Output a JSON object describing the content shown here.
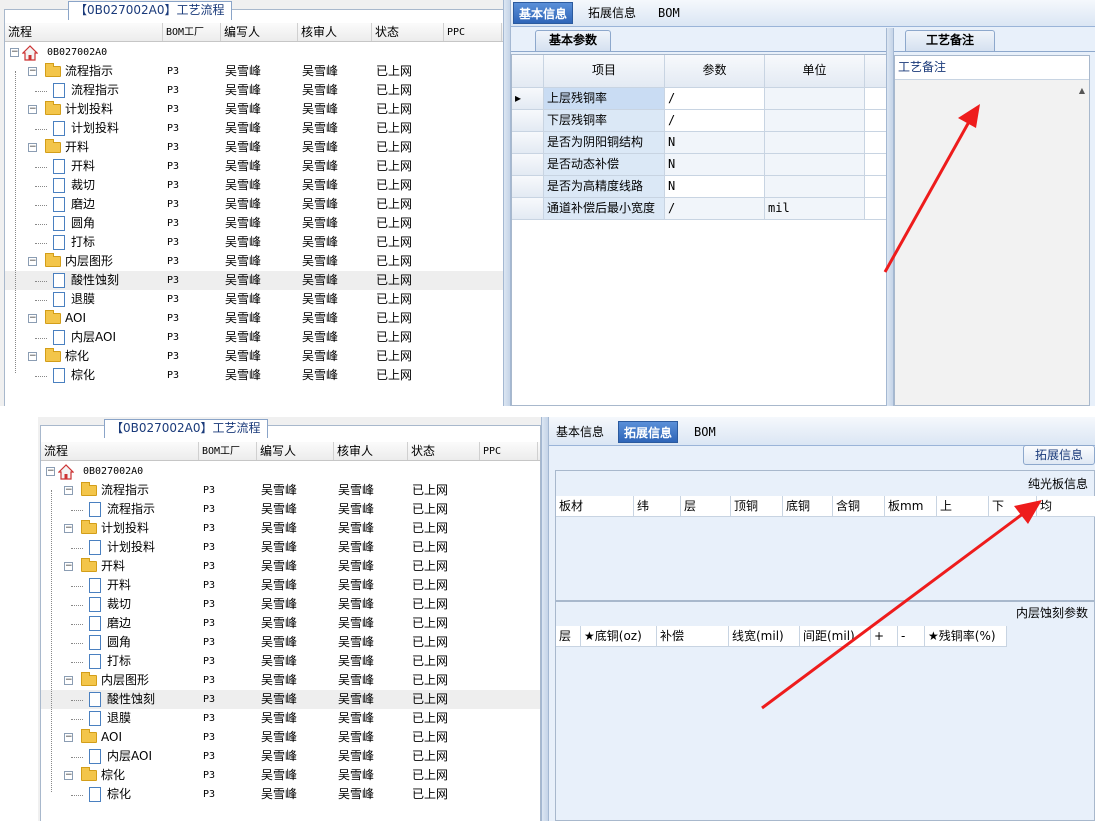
{
  "screen1": {
    "left_title": "【0B027002A0】工艺流程",
    "columns": [
      "流程",
      "BOM工厂",
      "编写人",
      "核审人",
      "状态",
      "PPC"
    ],
    "tabs": [
      "基本信息",
      "拓展信息",
      "BOM"
    ],
    "subtab": "基本参数",
    "remark_tab": "工艺备注",
    "remark_label": "工艺备注",
    "grid_headers": [
      "项目",
      "参数",
      "单位"
    ],
    "grid_rows": [
      {
        "item": "上层残铜率",
        "value": "/",
        "unit": ""
      },
      {
        "item": "下层残铜率",
        "value": "/",
        "unit": ""
      },
      {
        "item": "是否为阴阳铜结构",
        "value": "N",
        "unit": ""
      },
      {
        "item": "是否动态补偿",
        "value": "N",
        "unit": ""
      },
      {
        "item": "是否为高精度线路",
        "value": "N",
        "unit": ""
      },
      {
        "item": "通道补偿后最小宽度",
        "value": "/",
        "unit": "mil"
      }
    ]
  },
  "screen2": {
    "left_title": "【0B027002A0】工艺流程",
    "columns": [
      "流程",
      "BOM工厂",
      "编写人",
      "核审人",
      "状态",
      "PPC"
    ],
    "tabs": [
      "基本信息",
      "拓展信息",
      "BOM"
    ],
    "ext_button": "拓展信息",
    "section1_title": "纯光板信息",
    "section1_headers": [
      "板材",
      "纬",
      "层",
      "顶铜",
      "底铜",
      "含铜",
      "板mm",
      "上",
      "下",
      "均"
    ],
    "section2_title": "内层蚀刻参数",
    "section2_headers": [
      "层",
      "★底铜(oz)",
      "补偿",
      "线宽(mil)",
      "间距(mil)",
      "+",
      "-",
      "★残铜率(%)"
    ]
  },
  "tree": [
    {
      "label": "0B027002A0",
      "type": "root",
      "level": 0,
      "bom": "",
      "writer": "",
      "reviewer": "",
      "status": ""
    },
    {
      "label": "流程指示",
      "type": "folder",
      "level": 1,
      "bom": "P3",
      "writer": "吴雪峰",
      "reviewer": "吴雪峰",
      "status": "已上网"
    },
    {
      "label": "流程指示",
      "type": "doc",
      "level": 2,
      "bom": "P3",
      "writer": "吴雪峰",
      "reviewer": "吴雪峰",
      "status": "已上网"
    },
    {
      "label": "计划投料",
      "type": "folder",
      "level": 1,
      "bom": "P3",
      "writer": "吴雪峰",
      "reviewer": "吴雪峰",
      "status": "已上网"
    },
    {
      "label": "计划投料",
      "type": "doc",
      "level": 2,
      "bom": "P3",
      "writer": "吴雪峰",
      "reviewer": "吴雪峰",
      "status": "已上网"
    },
    {
      "label": "开料",
      "type": "folder",
      "level": 1,
      "bom": "P3",
      "writer": "吴雪峰",
      "reviewer": "吴雪峰",
      "status": "已上网"
    },
    {
      "label": "开料",
      "type": "doc",
      "level": 2,
      "bom": "P3",
      "writer": "吴雪峰",
      "reviewer": "吴雪峰",
      "status": "已上网"
    },
    {
      "label": "裁切",
      "type": "doc",
      "level": 2,
      "bom": "P3",
      "writer": "吴雪峰",
      "reviewer": "吴雪峰",
      "status": "已上网"
    },
    {
      "label": "磨边",
      "type": "doc",
      "level": 2,
      "bom": "P3",
      "writer": "吴雪峰",
      "reviewer": "吴雪峰",
      "status": "已上网"
    },
    {
      "label": "圆角",
      "type": "doc",
      "level": 2,
      "bom": "P3",
      "writer": "吴雪峰",
      "reviewer": "吴雪峰",
      "status": "已上网"
    },
    {
      "label": "打标",
      "type": "doc",
      "level": 2,
      "bom": "P3",
      "writer": "吴雪峰",
      "reviewer": "吴雪峰",
      "status": "已上网"
    },
    {
      "label": "内层图形",
      "type": "folder",
      "level": 1,
      "bom": "P3",
      "writer": "吴雪峰",
      "reviewer": "吴雪峰",
      "status": "已上网"
    },
    {
      "label": "酸性蚀刻",
      "type": "doc",
      "level": 2,
      "bom": "P3",
      "writer": "吴雪峰",
      "reviewer": "吴雪峰",
      "status": "已上网",
      "selected": true
    },
    {
      "label": "退膜",
      "type": "doc",
      "level": 2,
      "bom": "P3",
      "writer": "吴雪峰",
      "reviewer": "吴雪峰",
      "status": "已上网"
    },
    {
      "label": "AOI",
      "type": "folder",
      "level": 1,
      "bom": "P3",
      "writer": "吴雪峰",
      "reviewer": "吴雪峰",
      "status": "已上网"
    },
    {
      "label": "内层AOI",
      "type": "doc",
      "level": 2,
      "bom": "P3",
      "writer": "吴雪峰",
      "reviewer": "吴雪峰",
      "status": "已上网"
    },
    {
      "label": "棕化",
      "type": "folder",
      "level": 1,
      "bom": "P3",
      "writer": "吴雪峰",
      "reviewer": "吴雪峰",
      "status": "已上网"
    },
    {
      "label": "棕化",
      "type": "doc",
      "level": 2,
      "bom": "P3",
      "writer": "吴雪峰",
      "reviewer": "吴雪峰",
      "status": "已上网"
    }
  ],
  "colors": {
    "accent": "#2e65b8",
    "arrow": "#ee1c1c",
    "pane_bg": "#e8f0fa"
  }
}
